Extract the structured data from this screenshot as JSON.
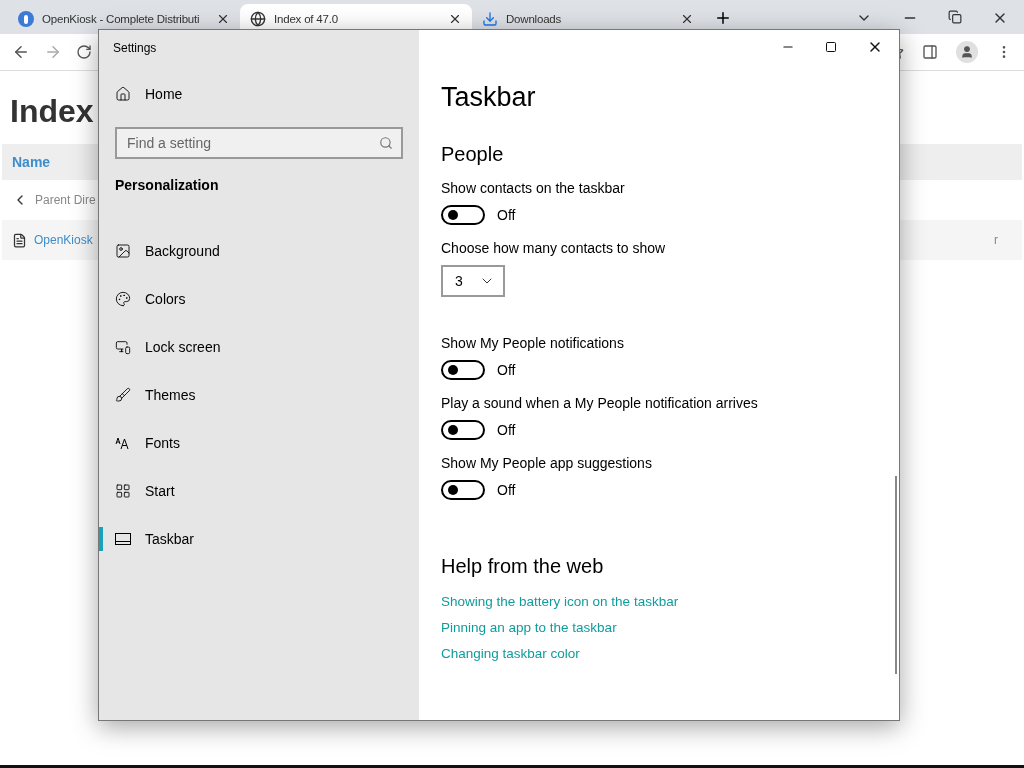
{
  "browser": {
    "tabs": [
      {
        "title": "OpenKiosk - Complete Distributi",
        "selected": false
      },
      {
        "title": "Index of 47.0",
        "selected": true
      },
      {
        "title": "Downloads",
        "selected": false
      }
    ],
    "page": {
      "heading": "Index",
      "column": "Name",
      "rows": [
        {
          "kind": "parent",
          "text": "Parent Dire"
        },
        {
          "kind": "file",
          "text": "OpenKiosk",
          "trailing": "r"
        }
      ]
    }
  },
  "settings": {
    "window": {
      "title": "Settings"
    },
    "home": "Home",
    "search": {
      "placeholder": "Find a setting"
    },
    "section": "Personalization",
    "nav": [
      {
        "label": "Background",
        "selected": false
      },
      {
        "label": "Colors",
        "selected": false
      },
      {
        "label": "Lock screen",
        "selected": false
      },
      {
        "label": "Themes",
        "selected": false
      },
      {
        "label": "Fonts",
        "selected": false
      },
      {
        "label": "Start",
        "selected": false
      },
      {
        "label": "Taskbar",
        "selected": true
      }
    ],
    "page_title": "Taskbar",
    "group": "People",
    "settings": [
      {
        "kind": "toggle",
        "label": "Show contacts on the taskbar",
        "on": false,
        "state": "Off"
      },
      {
        "kind": "dropdown",
        "label": "Choose how many contacts to show",
        "value": "3"
      },
      {
        "kind": "toggle",
        "label": "Show My People notifications",
        "on": false,
        "state": "Off"
      },
      {
        "kind": "toggle",
        "label": "Play a sound when a My People notification arrives",
        "on": false,
        "state": "Off"
      },
      {
        "kind": "toggle",
        "label": "Show My People app suggestions",
        "on": false,
        "state": "Off"
      }
    ],
    "help": {
      "title": "Help from the web",
      "links": [
        "Showing the battery icon on the taskbar",
        "Pinning an app to the taskbar",
        "Changing taskbar color"
      ]
    }
  }
}
